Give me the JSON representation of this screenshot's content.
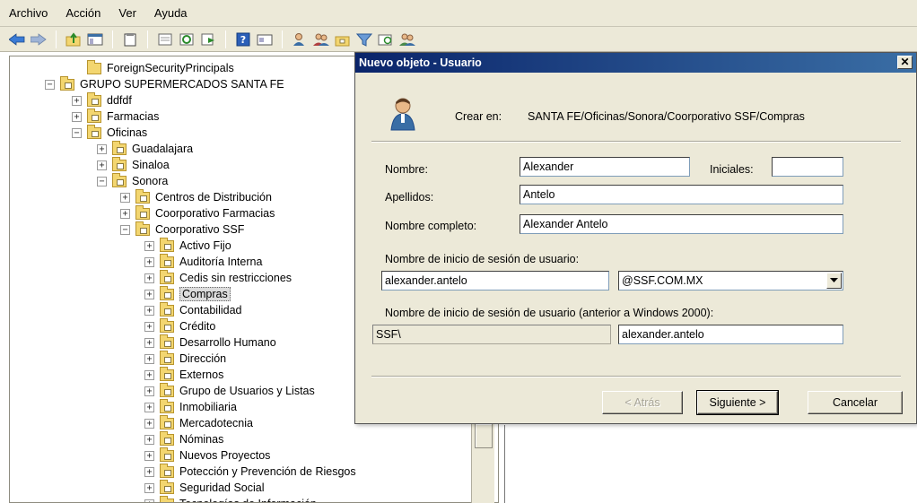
{
  "menu": [
    "Archivo",
    "Acción",
    "Ver",
    "Ayuda"
  ],
  "tree": {
    "items": [
      {
        "label": "ForeignSecurityPrincipals",
        "level": 2,
        "expander": "",
        "ou": false
      },
      {
        "label": "GRUPO SUPERMERCADOS SANTA FE",
        "level": 1,
        "expander": "−",
        "ou": true
      },
      {
        "label": "ddfdf",
        "level": 2,
        "expander": "+",
        "ou": true
      },
      {
        "label": "Farmacias",
        "level": 2,
        "expander": "+",
        "ou": true
      },
      {
        "label": "Oficinas",
        "level": 2,
        "expander": "−",
        "ou": true
      },
      {
        "label": "Guadalajara",
        "level": 3,
        "expander": "+",
        "ou": true
      },
      {
        "label": "Sinaloa",
        "level": 3,
        "expander": "+",
        "ou": true
      },
      {
        "label": "Sonora",
        "level": 3,
        "expander": "−",
        "ou": true
      },
      {
        "label": "Centros de Distribución",
        "level": 4,
        "expander": "+",
        "ou": true
      },
      {
        "label": "Coorporativo Farmacias",
        "level": 4,
        "expander": "+",
        "ou": true
      },
      {
        "label": "Coorporativo SSF",
        "level": 4,
        "expander": "−",
        "ou": true
      },
      {
        "label": "Activo Fijo",
        "level": 5,
        "expander": "+",
        "ou": true
      },
      {
        "label": "Auditoría Interna",
        "level": 5,
        "expander": "+",
        "ou": true
      },
      {
        "label": "Cedis sin restricciones",
        "level": 5,
        "expander": "+",
        "ou": true
      },
      {
        "label": "Compras",
        "level": 5,
        "expander": "+",
        "ou": true,
        "selected": true
      },
      {
        "label": "Contabilidad",
        "level": 5,
        "expander": "+",
        "ou": true
      },
      {
        "label": "Crédito",
        "level": 5,
        "expander": "+",
        "ou": true
      },
      {
        "label": "Desarrollo Humano",
        "level": 5,
        "expander": "+",
        "ou": true
      },
      {
        "label": "Dirección",
        "level": 5,
        "expander": "+",
        "ou": true
      },
      {
        "label": "Externos",
        "level": 5,
        "expander": "+",
        "ou": true
      },
      {
        "label": "Grupo de Usuarios y Listas",
        "level": 5,
        "expander": "+",
        "ou": true
      },
      {
        "label": "Inmobiliaria",
        "level": 5,
        "expander": "+",
        "ou": true
      },
      {
        "label": "Mercadotecnia",
        "level": 5,
        "expander": "+",
        "ou": true
      },
      {
        "label": "Nóminas",
        "level": 5,
        "expander": "+",
        "ou": true
      },
      {
        "label": "Nuevos Proyectos",
        "level": 5,
        "expander": "+",
        "ou": true
      },
      {
        "label": "Potección y Prevención de Riesgos",
        "level": 5,
        "expander": "+",
        "ou": true
      },
      {
        "label": "Seguridad Social",
        "level": 5,
        "expander": "+",
        "ou": true
      },
      {
        "label": "Tecnologías de Información",
        "level": 5,
        "expander": "+",
        "ou": true
      }
    ]
  },
  "dialog": {
    "title": "Nuevo objeto - Usuario",
    "close_glyph": "✕",
    "crear_label": "Crear en:",
    "crear_path": "SANTA FE/Oficinas/Sonora/Coorporativo SSF/Compras",
    "nombre_label": "Nombre:",
    "nombre_value": "Alexander",
    "iniciales_label": "Iniciales:",
    "iniciales_value": "",
    "apellidos_label": "Apellidos:",
    "apellidos_value": "Antelo",
    "nombre_completo_label": "Nombre completo:",
    "nombre_completo_value": "Alexander Antelo",
    "logon_label": "Nombre de inicio de sesión de usuario:",
    "logon_value": "alexander.antelo",
    "domain_value": "@SSF.COM.MX",
    "pre2000_label": "Nombre de inicio de sesión de usuario (anterior a Windows 2000):",
    "pre2000_domain": "SSF\\",
    "pre2000_value": "alexander.antelo",
    "back_label": "< Atrás",
    "next_label": "Siguiente >",
    "cancel_label": "Cancelar"
  }
}
